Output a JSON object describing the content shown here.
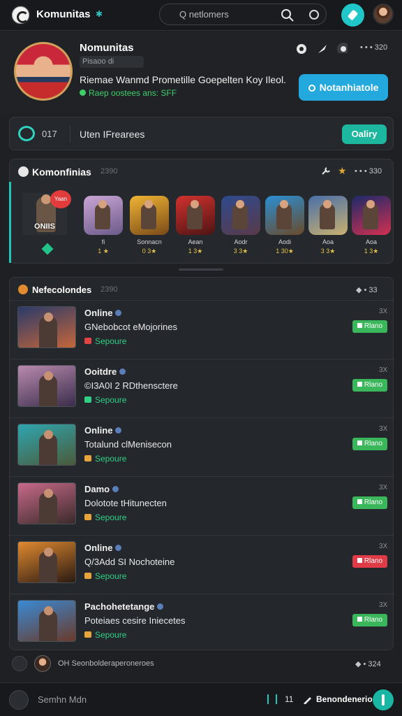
{
  "app": {
    "title": "Komunitas",
    "title_badge": "✱"
  },
  "search": {
    "placeholder": "Q netlomers"
  },
  "profile": {
    "name": "Nomunitas",
    "sub": "Pisaoo di",
    "description": "Riemae Wanmd Prometille Goepelten Koy Ileol.",
    "status": "Raep oostees ans: SFF",
    "menu": "• • • 320",
    "primary_button": "Notanhiatole"
  },
  "online_bar": {
    "count": "017",
    "label": "Uten IFrearees",
    "button": "Oaliry"
  },
  "community": {
    "title": "Komonfinias",
    "count": "2390",
    "menu": "• • • 330",
    "featured": {
      "badge": "Yaan",
      "label": "ONIIS"
    },
    "games": [
      {
        "label": "fi",
        "rating": "1 ★"
      },
      {
        "label": "Sonnacn",
        "rating": "0 3★"
      },
      {
        "label": "Aean",
        "rating": "1 3★"
      },
      {
        "label": "Aodr",
        "rating": "3 3★"
      },
      {
        "label": "Aodi",
        "rating": "1 30★"
      },
      {
        "label": "Aoa",
        "rating": "3 3★"
      },
      {
        "label": "Aoa",
        "rating": "1 3★"
      }
    ]
  },
  "members": {
    "title": "Nefecolondes",
    "count": "2390",
    "menu": "◆ • 33",
    "rows": [
      {
        "status": "Online",
        "name": "GNebobcot eMojorines",
        "tag": "Sepoure",
        "button": "Rlano",
        "tag_color": "#e24343",
        "btn_color": "#39b75a"
      },
      {
        "status": "Ooitdre",
        "name": "©I3A0I 2 RDthensctere",
        "tag": "Sepoure",
        "button": "Rlano",
        "tag_color": "#2fcf86",
        "btn_color": "#39b75a"
      },
      {
        "status": "Online",
        "name": "Totalund clMenisecon",
        "tag": "Sepoure",
        "button": "Rlano",
        "tag_color": "#e8a53a",
        "btn_color": "#39b75a"
      },
      {
        "status": "Damo",
        "name": "Dolotote tHitunecten",
        "tag": "Sepoure",
        "button": "Rlano",
        "tag_color": "#e8a53a",
        "btn_color": "#39b75a"
      },
      {
        "status": "Online",
        "name": "Q/3Add SI Nochoteine",
        "tag": "Sepoure",
        "button": "Rlano",
        "tag_color": "#e8a53a",
        "btn_color": "#e03c48"
      },
      {
        "status": "Pachohetetange",
        "name": "Poteiaes cesire Iniecetes",
        "tag": "Sepoure",
        "button": "Rlano",
        "tag_color": "#e8a53a",
        "btn_color": "#39b75a"
      }
    ],
    "x_label": "3X"
  },
  "footer": {
    "text": "OH Seonbolderaperoneroes",
    "right": "◆ • 324"
  },
  "bottom": {
    "input_placeholder": "Semhn Mdn",
    "count": "11",
    "label": "Benondenerio"
  },
  "colors": {
    "accent": "#20c6c8",
    "primary": "#24a9df",
    "success": "#39b75a",
    "danger": "#e03c48"
  }
}
